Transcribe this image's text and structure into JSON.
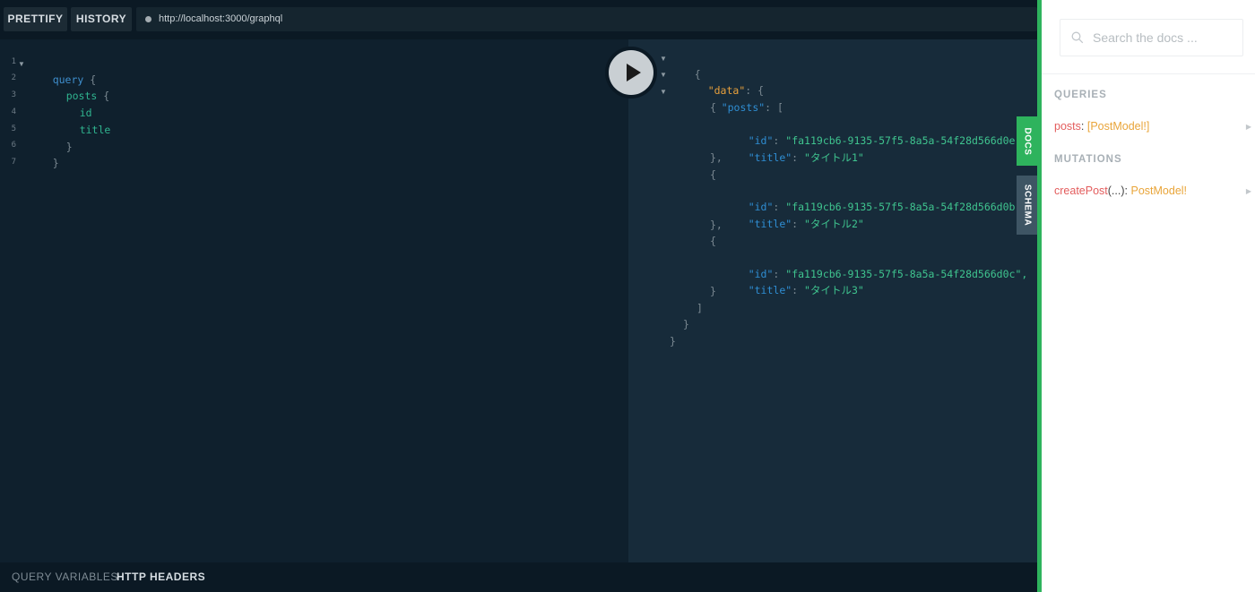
{
  "toolbar": {
    "prettify_label": "PRETTIFY",
    "history_label": "HISTORY",
    "url": "http://localhost:3000/graphql"
  },
  "editor": {
    "line_numbers": [
      "1",
      "2",
      "3",
      "4",
      "5",
      "6",
      "7"
    ],
    "tokens": {
      "query_kw": "query",
      "open_brace": "{",
      "posts_field": "posts",
      "id_field": "id",
      "title_field": "title",
      "close_brace": "}"
    }
  },
  "result": {
    "open_brace": "{",
    "close_brace": "}",
    "data_key": "\"data\"",
    "posts_key": "\"posts\"",
    "open_bracket": "[",
    "close_bracket": "]",
    "colon": ":",
    "id_key": "\"id\"",
    "title_key": "\"title\"",
    "posts": [
      {
        "id": "\"fa119cb6-9135-57f5-8a5a-54f28d566d0e\"",
        "title": "\"タイトル1\""
      },
      {
        "id": "\"fa119cb6-9135-57f5-8a5a-54f28d566d0b\"",
        "title": "\"タイトル2\""
      },
      {
        "id": "\"fa119cb6-9135-57f5-8a5a-54f28d566d0c\",",
        "title": "\"タイトル3\""
      }
    ],
    "obj_close_comma": "},"
  },
  "bottom": {
    "query_variables": "QUERY VARIABLES",
    "http_headers": "HTTP HEADERS"
  },
  "side_tabs": {
    "docs": "DOCS",
    "schema": "SCHEMA"
  },
  "docs": {
    "search_placeholder": "Search the docs ...",
    "queries_title": "QUERIES",
    "mutations_title": "MUTATIONS",
    "query_item": {
      "name": "posts",
      "colon": ":",
      "type": "[PostModel!]"
    },
    "mutation_item": {
      "name": "createPost",
      "args": "(...)",
      "colon": ":",
      "type": "PostModel!"
    }
  },
  "colors": {
    "accent_green": "#2eb35d",
    "editor_bg": "#0f202d",
    "result_bg": "#172b3a"
  }
}
